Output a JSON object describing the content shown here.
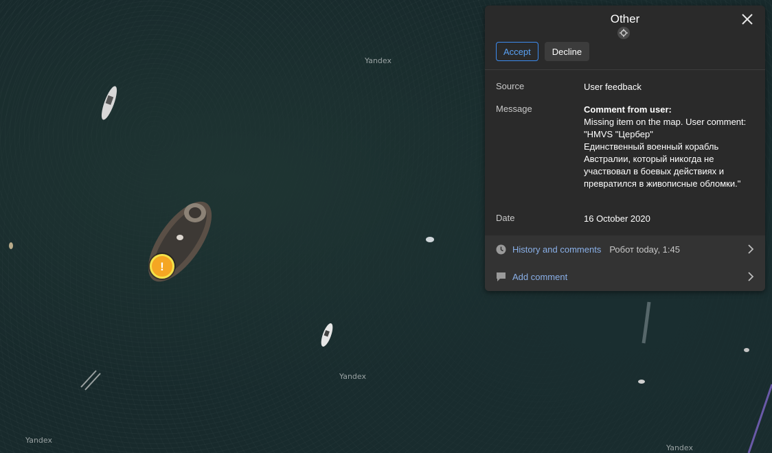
{
  "map": {
    "watermarks": [
      "Yandex",
      "Yandex",
      "Yandex",
      "Yandex"
    ]
  },
  "panel": {
    "title": "Other",
    "accept_label": "Accept",
    "decline_label": "Decline",
    "source_label": "Source",
    "source_value": "User feedback",
    "message_label": "Message",
    "message_heading": "Comment from user:",
    "message_lines": [
      "Missing item on the map. User comment:",
      "\"HMVS \"Цербер\"",
      "Единственный военный корабль",
      "Австралии, который никогда не",
      "участвовал в боевых действиях и",
      "превратился в живописные обломки.\""
    ],
    "date_label": "Date",
    "date_value": "16 October 2020",
    "history_label": "History and comments",
    "history_meta": "Робот today, 1:45",
    "add_comment_label": "Add comment"
  },
  "colors": {
    "accent": "#3d8cf0",
    "marker": "#f5a623",
    "marker_ring": "#f3e24a",
    "panel_bg": "#2a2a2a"
  },
  "icons": {
    "close": "close-icon",
    "locate": "locate-icon",
    "history": "clock-icon",
    "comment": "comment-icon",
    "chevron": "chevron-right-icon",
    "marker": "warning-marker-icon"
  }
}
